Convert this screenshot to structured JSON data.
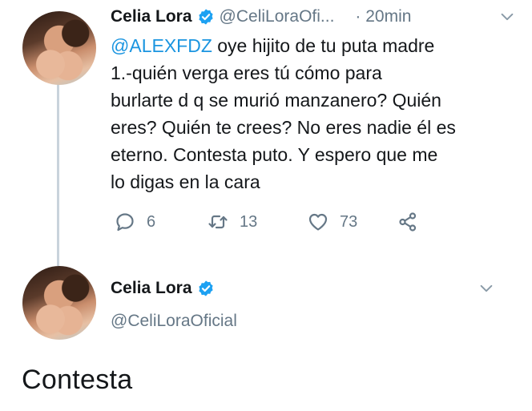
{
  "colors": {
    "accent": "#1b95e0",
    "muted": "#657786",
    "text": "#14171a",
    "thread_line": "#c9d3dc"
  },
  "tweet": {
    "display_name": "Celia Lora",
    "handle": "@CeliLoraOfi...",
    "timestamp": "· 20min",
    "mention": "@ALEXFDZ",
    "text_after_mention": " oye hijito de tu puta madre\n1.-quién verga eres tú cómo para\nburlarte d q se murió manzanero? Quién\neres? Quién te crees? No eres nadie él es\neterno. Contesta puto. Y espero que me\nlo digas en la cara",
    "actions": {
      "reply_count": "6",
      "retweet_count": "13",
      "like_count": "73"
    },
    "icons": [
      "verified-icon",
      "chevron-down-icon",
      "reply-icon",
      "retweet-icon",
      "like-icon",
      "share-icon"
    ]
  },
  "reply_tweet": {
    "display_name": "Celia Lora",
    "handle": "@CeliLoraOficial",
    "text": "Contesta"
  }
}
